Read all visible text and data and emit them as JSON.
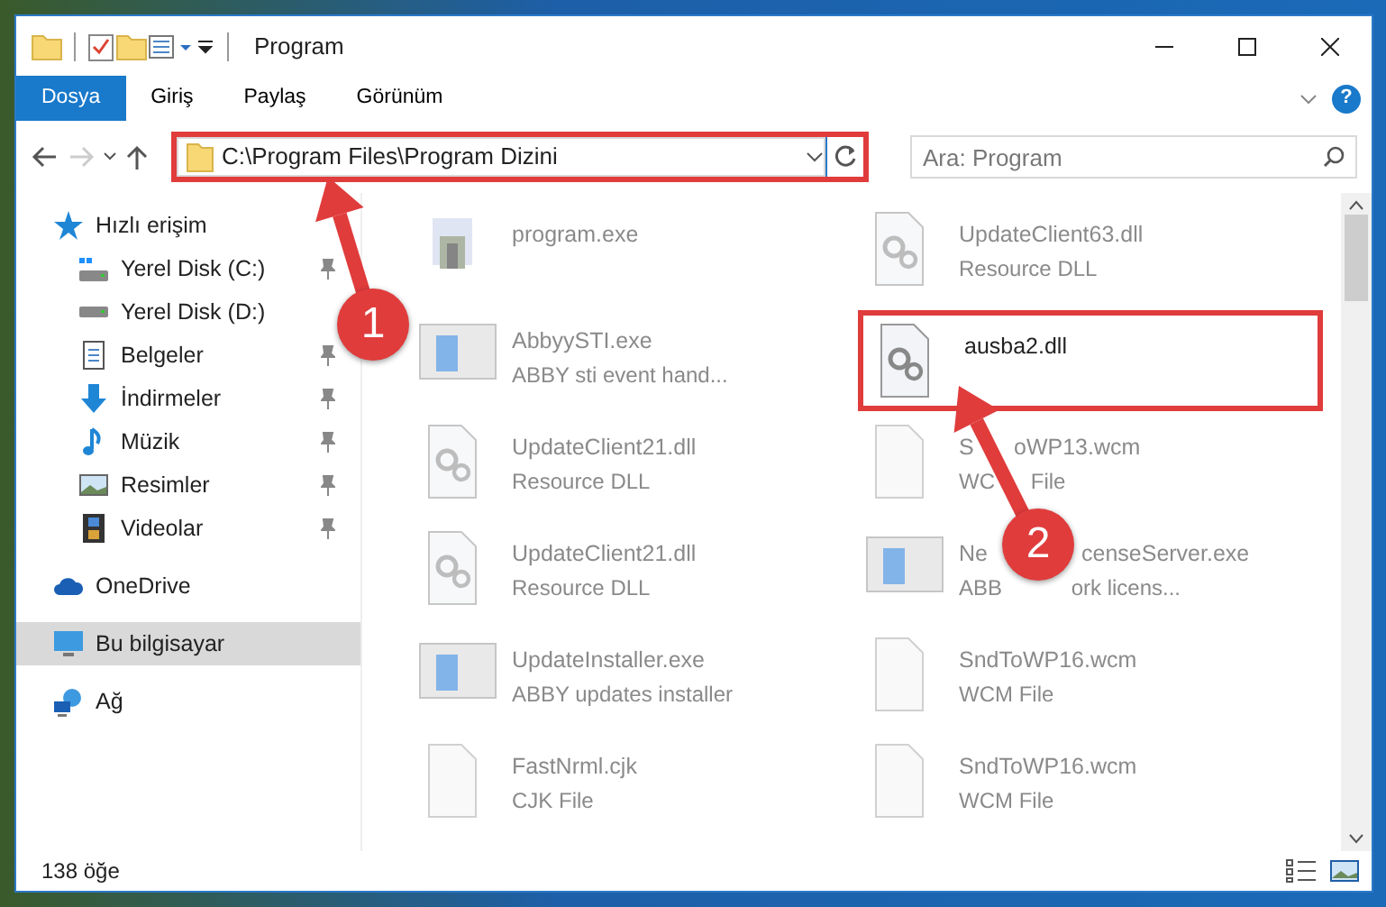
{
  "window": {
    "title": "Program"
  },
  "ribbon": {
    "tabs": [
      {
        "label": "Dosya",
        "kind": "file"
      },
      {
        "label": "Giriş",
        "kind": "tab"
      },
      {
        "label": "Paylaş",
        "kind": "tab"
      },
      {
        "label": "Görünüm",
        "kind": "tab"
      }
    ],
    "help_label": "?"
  },
  "address_bar": {
    "path": "C:\\Program Files\\Program Dizini",
    "framed": true,
    "forward_disabled": true
  },
  "search": {
    "placeholder": "Ara: Program"
  },
  "sidebar": {
    "items": [
      {
        "label": "Hızlı erişim",
        "kind": "star",
        "selected": false,
        "children": [
          {
            "label": "Yerel Disk (C:)",
            "kind": "drive-c",
            "pinned": true,
            "selected": false
          },
          {
            "label": "Yerel Disk (D:)",
            "kind": "drive",
            "selected": false
          },
          {
            "label": "Belgeler",
            "kind": "documents",
            "pinned": true,
            "selected": false
          },
          {
            "label": "İndirmeler",
            "kind": "downloads",
            "pinned": true,
            "selected": false
          },
          {
            "label": "Müzik",
            "kind": "music",
            "pinned": true,
            "selected": false
          },
          {
            "label": "Resimler",
            "kind": "pictures",
            "pinned": true,
            "selected": false
          },
          {
            "label": "Videolar",
            "kind": "videos",
            "pinned": true,
            "selected": false
          }
        ]
      },
      {
        "label": "OneDrive",
        "kind": "cloud",
        "selected": false
      },
      {
        "label": "Bu bilgisayar",
        "kind": "computer",
        "selected": true
      },
      {
        "label": "Ağ",
        "kind": "network",
        "selected": false
      }
    ]
  },
  "files": [
    {
      "name_parts": [
        "program.exe"
      ],
      "kind": "app",
      "dimmed": true,
      "framed": false
    },
    {
      "name_parts": [
        "UpdateClient63.dll"
      ],
      "description_parts": [
        "Resource DLL"
      ],
      "kind": "dll",
      "dimmed": true,
      "framed": false
    },
    {
      "name_parts": [
        "AbbyySTI.exe"
      ],
      "description_parts": [
        "ABBY sti event hand..."
      ],
      "kind": "window",
      "dimmed": true,
      "framed": false
    },
    {
      "name_parts": [
        "ausba2.dll"
      ],
      "kind": "dll",
      "dimmed": false,
      "framed": true
    },
    {
      "name_parts": [
        "UpdateClient21.dll"
      ],
      "description_parts": [
        "Resource DLL"
      ],
      "kind": "dll",
      "dimmed": true,
      "framed": false
    },
    {
      "name_parts": [
        "S",
        "oWP13.wcm"
      ],
      "description_parts": [
        "WC",
        "File"
      ],
      "kind": "blank",
      "dimmed": true,
      "framed": false
    },
    {
      "name_parts": [
        "UpdateClient21.dll"
      ],
      "description_parts": [
        "Resource DLL"
      ],
      "kind": "dll",
      "dimmed": true,
      "framed": false
    },
    {
      "name_parts": [
        "Ne",
        "censeServer.exe"
      ],
      "description_parts": [
        "ABB",
        "ork licens..."
      ],
      "kind": "window",
      "dimmed": true,
      "framed": false
    },
    {
      "name_parts": [
        "UpdateInstaller.exe"
      ],
      "description_parts": [
        "ABBY updates installer"
      ],
      "kind": "window",
      "dimmed": true,
      "framed": false
    },
    {
      "name_parts": [
        "SndToWP16.wcm"
      ],
      "description_parts": [
        "WCM File"
      ],
      "kind": "blank",
      "dimmed": true,
      "framed": false
    },
    {
      "name_parts": [
        "FastNrml.cjk"
      ],
      "description_parts": [
        "CJK File"
      ],
      "kind": "blank",
      "dimmed": true,
      "framed": false
    },
    {
      "name_parts": [
        "SndToWP16.wcm"
      ],
      "description_parts": [
        "WCM File"
      ],
      "kind": "blank",
      "dimmed": true,
      "framed": false
    }
  ],
  "status_bar": {
    "item_count": "138 öğe"
  },
  "callouts": [
    {
      "number": "1"
    },
    {
      "number": "2"
    }
  ]
}
